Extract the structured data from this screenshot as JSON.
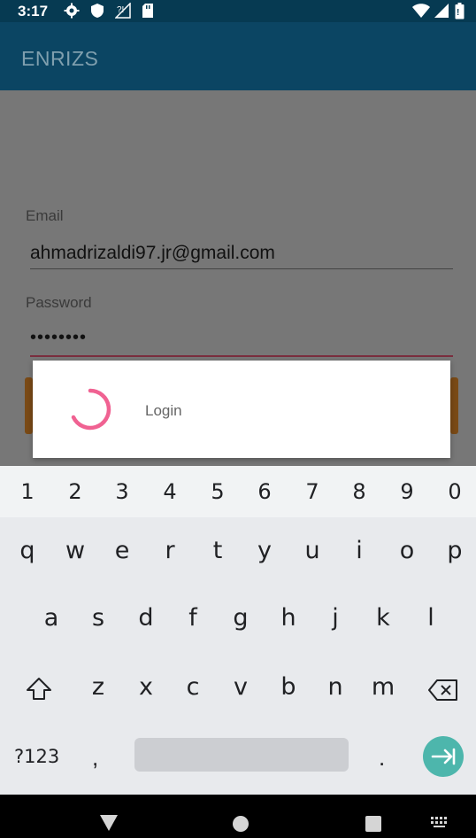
{
  "status_bar": {
    "time": "3:17",
    "icons_left": [
      "settings-icon",
      "shield-icon",
      "signal-unknown-icon",
      "sd-card-icon"
    ],
    "icons_right": [
      "wifi-icon",
      "signal-icon",
      "battery-icon"
    ]
  },
  "app_bar": {
    "title": "ENRIZS"
  },
  "form": {
    "email_label": "Email",
    "email_value": "ahmadrizaldi97.jr@gmail.com",
    "password_label": "Password",
    "password_value": "••••••••"
  },
  "dialog": {
    "message": "Login",
    "accent": "#f06292"
  },
  "keyboard": {
    "numbers": [
      "1",
      "2",
      "3",
      "4",
      "5",
      "6",
      "7",
      "8",
      "9",
      "0"
    ],
    "row1": [
      "q",
      "w",
      "e",
      "r",
      "t",
      "y",
      "u",
      "i",
      "o",
      "p"
    ],
    "row2": [
      "a",
      "s",
      "d",
      "f",
      "g",
      "h",
      "j",
      "k",
      "l"
    ],
    "row3": [
      "z",
      "x",
      "c",
      "v",
      "b",
      "n",
      "m"
    ],
    "symbols_label": "?123",
    "comma": ",",
    "period": ".",
    "enter_color": "#4db6ac"
  },
  "nav_bar": {
    "icons": [
      "back-icon",
      "home-icon",
      "recents-icon",
      "keyboard-switch-icon"
    ]
  },
  "colors": {
    "status_bar": "#063a52",
    "app_bar": "#0b4563",
    "scrim": "#777777"
  }
}
